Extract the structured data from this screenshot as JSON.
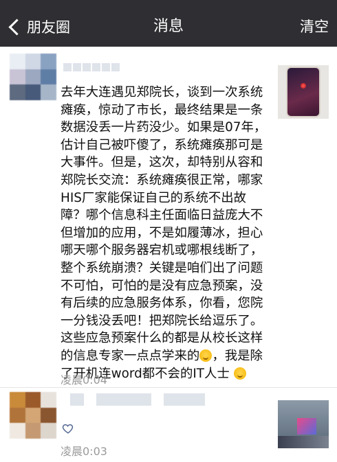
{
  "navbar": {
    "back_label": "朋友圈",
    "title": "消息",
    "clear_label": "清空"
  },
  "messages": [
    {
      "text_before_emoji1": "去年大连遇见郑院长，谈到一次系统瘫痪，惊动了市长，最终结果是一条数据没丢一片药没少。如果是07年，估计自己被吓傻了，系统瘫痪那可是大事件。但是，这次，却特别从容和郑院长交流：系统瘫痪很正常，哪家HIS厂家能保证自己的系统不出故障？哪个信息科主任面临日益庞大不但增加的应用，不是如履薄冰，担心哪天哪个服务器宕机或哪根线断了，整个系统崩溃？关键是咱们出了问题不可怕，可怕的是没有应急预案，没有后续的应急服务体系，你看，您院一分钱没丢吧！把郑院长给逗乐了。这些应急预案什么的都是从校长这样的信息专家一点点学来的",
      "text_between_emojis": "，我是除了开机连word都不会的IT人士",
      "emoji_icons": [
        "thinking-face-icon",
        "winking-tongue-face-icon"
      ],
      "time": "凌晨0:04",
      "thumbnail": "phone-photo"
    },
    {
      "type": "like",
      "time": "凌晨0:03",
      "thumbnail": "room-photo"
    }
  ],
  "colors": {
    "navbar_bg": "#2f2f33",
    "time_text": "#9a9a9a",
    "divider": "#e4e4e4"
  }
}
